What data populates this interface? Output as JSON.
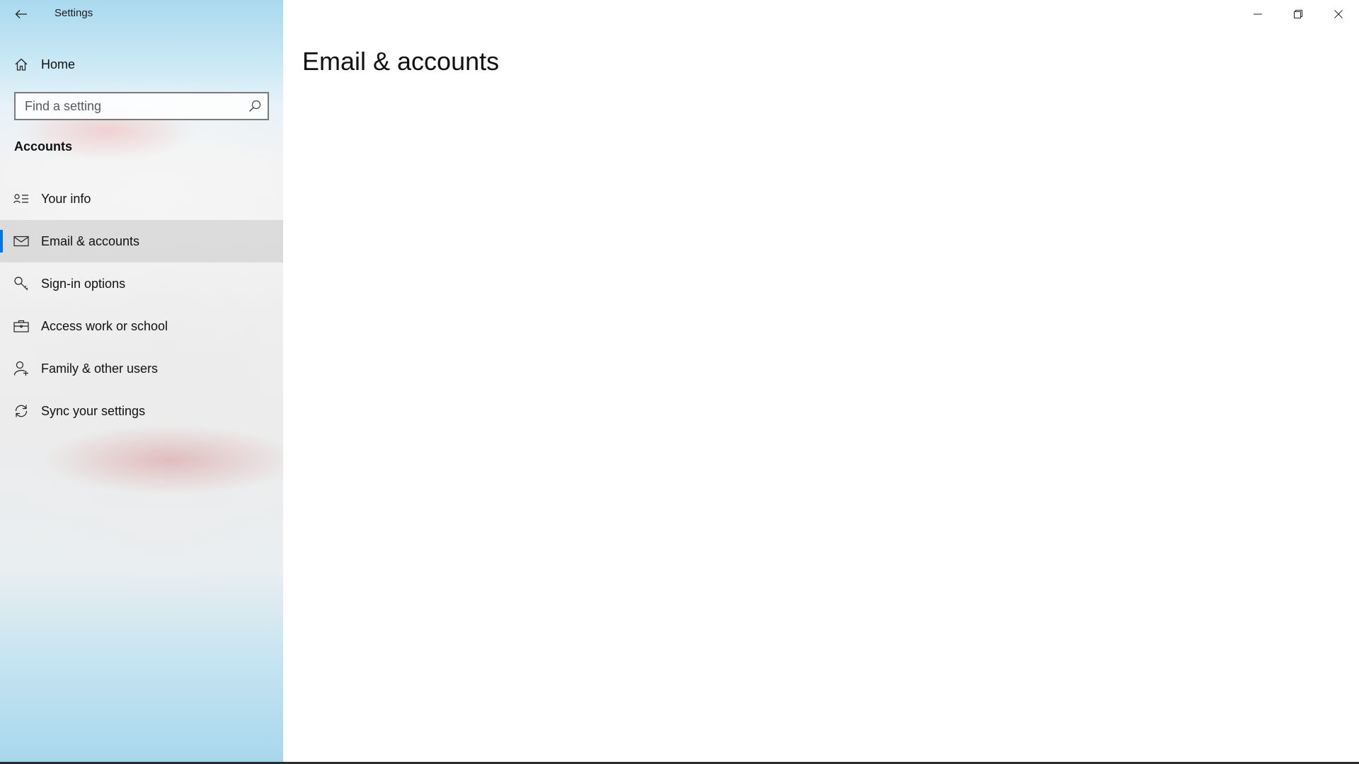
{
  "window": {
    "title": "Settings",
    "caption": {
      "minimize_icon": "minimize-icon",
      "restore_icon": "restore-icon",
      "close_icon": "close-icon"
    }
  },
  "sidebar": {
    "back_icon": "back-arrow-icon",
    "home": {
      "label": "Home",
      "icon": "home-icon"
    },
    "search": {
      "placeholder": "Find a setting",
      "value": "",
      "icon": "search-icon"
    },
    "section_heading": "Accounts",
    "items": [
      {
        "label": "Your info",
        "icon": "contact-card-icon",
        "selected": false
      },
      {
        "label": "Email & accounts",
        "icon": "mail-icon",
        "selected": true
      },
      {
        "label": "Sign-in options",
        "icon": "key-icon",
        "selected": false
      },
      {
        "label": "Access work or school",
        "icon": "briefcase-icon",
        "selected": false
      },
      {
        "label": "Family & other users",
        "icon": "person-add-icon",
        "selected": false
      },
      {
        "label": "Sync your settings",
        "icon": "sync-icon",
        "selected": false
      }
    ]
  },
  "main": {
    "title": "Email & accounts"
  },
  "colors": {
    "accent": "#0078d7",
    "selected_row": "#d4d4d4",
    "text": "#111111"
  }
}
